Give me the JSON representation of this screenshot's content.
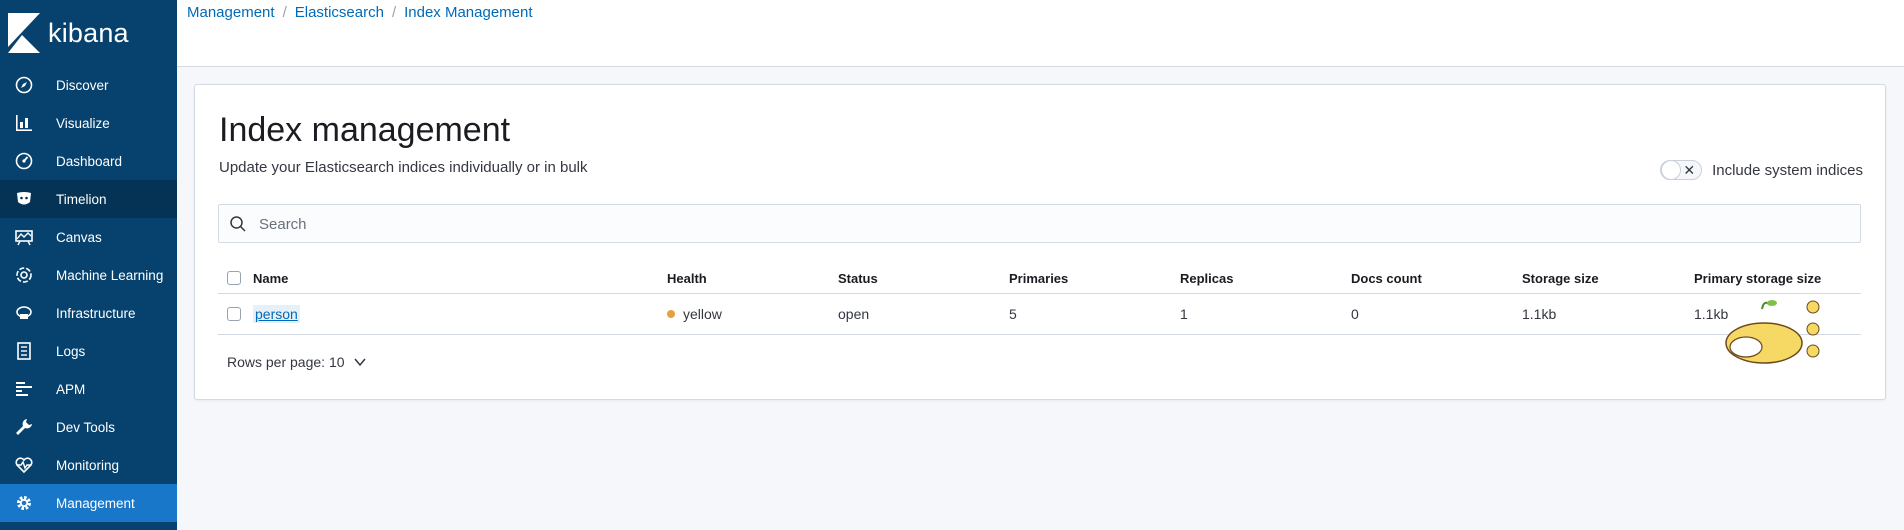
{
  "app": {
    "logo_text": "kibana"
  },
  "sidebar": {
    "items": [
      {
        "label": "Discover",
        "icon": "compass-icon"
      },
      {
        "label": "Visualize",
        "icon": "bar-chart-icon"
      },
      {
        "label": "Dashboard",
        "icon": "dashboard-icon"
      },
      {
        "label": "Timelion",
        "icon": "timelion-icon"
      },
      {
        "label": "Canvas",
        "icon": "canvas-icon"
      },
      {
        "label": "Machine Learning",
        "icon": "machine-learning-icon"
      },
      {
        "label": "Infrastructure",
        "icon": "infrastructure-icon"
      },
      {
        "label": "Logs",
        "icon": "logs-icon"
      },
      {
        "label": "APM",
        "icon": "apm-icon"
      },
      {
        "label": "Dev Tools",
        "icon": "wrench-icon"
      },
      {
        "label": "Monitoring",
        "icon": "monitoring-icon"
      },
      {
        "label": "Management",
        "icon": "gear-icon"
      }
    ]
  },
  "breadcrumb": [
    "Management",
    "Elasticsearch",
    "Index Management"
  ],
  "page": {
    "title": "Index management",
    "subtitle": "Update your Elasticsearch indices individually or in bulk",
    "toggle_label": "Include system indices",
    "toggle_on": false
  },
  "search": {
    "placeholder": "Search"
  },
  "table": {
    "columns": [
      "Name",
      "Health",
      "Status",
      "Primaries",
      "Replicas",
      "Docs count",
      "Storage size",
      "Primary storage size"
    ],
    "rows": [
      {
        "name": "person",
        "health": "yellow",
        "status": "open",
        "primaries": "5",
        "replicas": "1",
        "docs_count": "0",
        "storage_size": "1.1kb",
        "primary_storage_size": "1.1kb"
      }
    ]
  },
  "pagination": {
    "label": "Rows per page: 10"
  },
  "colors": {
    "sidebar_bg": "#07426e",
    "active_item": "#1877c9",
    "link": "#006bb8",
    "health_yellow": "#e7a13b"
  }
}
